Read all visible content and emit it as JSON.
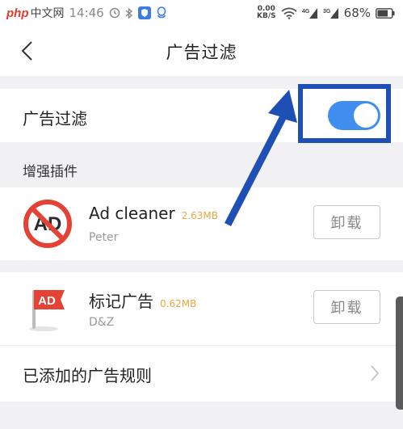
{
  "status_bar": {
    "watermark_logo": "php",
    "watermark_text": "中文网",
    "time": "14:46",
    "net_speed_value": "0.00",
    "net_speed_unit": "KB/S",
    "signal1": "4G",
    "signal2": "3G",
    "battery": "68%"
  },
  "header": {
    "title": "广告过滤"
  },
  "ad_filter": {
    "label": "广告过滤",
    "enabled": true
  },
  "section": {
    "title": "增强插件"
  },
  "plugins": [
    {
      "name": "Ad cleaner",
      "size": "2.63MB",
      "author": "Peter",
      "action": "卸载",
      "icon": "no-ad-icon"
    },
    {
      "name": "标记广告",
      "size": "0.62MB",
      "author": "D&Z",
      "action": "卸载",
      "icon": "ad-flag-icon"
    }
  ],
  "rules": {
    "label": "已添加的广告规则"
  },
  "colors": {
    "accent": "#3f8ef0",
    "annotation": "#1e4fb4",
    "size_text": "#e9a640",
    "icon_red": "#e34234"
  }
}
